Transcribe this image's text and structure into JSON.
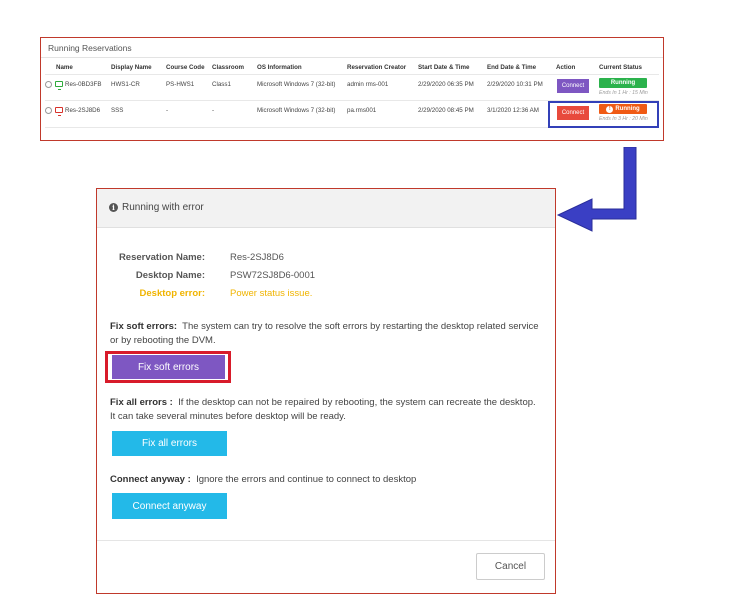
{
  "reservations": {
    "title": "Running Reservations",
    "columns": [
      "Name",
      "Display Name",
      "Course Code",
      "Classroom",
      "OS Information",
      "Reservation Creator",
      "Start Date & Time",
      "End Date & Time",
      "Action",
      "Current Status"
    ],
    "rows": [
      {
        "name": "Res-0BD3FB",
        "display_name": "HWS1-CR",
        "course_code": "PS-HWS1",
        "classroom": "Class1",
        "os": "Microsoft Windows 7 (32-bit)",
        "creator": "admin rms-001",
        "start": "2/29/2020 06:35 PM",
        "end": "2/29/2020 10:31 PM",
        "action": "Connect",
        "status": "Running",
        "ends_in": "Ends In 1 Hr : 15 Min",
        "monitor_color": "#2eaa3a",
        "status_color": "#2bb24c"
      },
      {
        "name": "Res-2SJ8D6",
        "display_name": "SSS",
        "course_code": "-",
        "classroom": "-",
        "os": "Microsoft Windows 7 (32-bit)",
        "creator": "pa.rms001",
        "start": "2/29/2020 08:45 PM",
        "end": "3/1/2020 12:36 AM",
        "action": "Connect",
        "status": "Running",
        "status_icon": "!",
        "ends_in": "Ends In 3 Hr : 20 Min",
        "monitor_color": "#d8322b",
        "status_color": "#f05a14"
      }
    ]
  },
  "dialog": {
    "title": "Running with error",
    "reservation_label": "Reservation Name:",
    "reservation_value": "Res-2SJ8D6",
    "desktop_label": "Desktop Name:",
    "desktop_value": "PSW72SJ8D6-0001",
    "error_label": "Desktop error:",
    "error_value": "Power status issue.",
    "fix_soft_heading": "Fix soft errors:",
    "fix_soft_text": "The system can try to resolve the soft errors by restarting the desktop related service or by rebooting the DVM.",
    "fix_soft_button": "Fix soft errors",
    "fix_all_heading": "Fix all errors :",
    "fix_all_text": "If the desktop can not be repaired by rebooting, the system can recreate the desktop. It can take several minutes before desktop will be ready.",
    "fix_all_button": "Fix all errors",
    "connect_heading": "Connect anyway :",
    "connect_text": "Ignore the errors and continue to connect to desktop",
    "connect_button": "Connect anyway",
    "cancel_button": "Cancel"
  },
  "colors": {
    "accent_purple": "#7e57c2",
    "accent_cyan": "#23b9e8",
    "warning": "#f0b400",
    "highlight_blue": "#3340b8",
    "highlight_red": "#d81b2a"
  },
  "icons": [
    "info-icon",
    "monitor-icon",
    "exclamation-icon",
    "arrow-icon"
  ]
}
